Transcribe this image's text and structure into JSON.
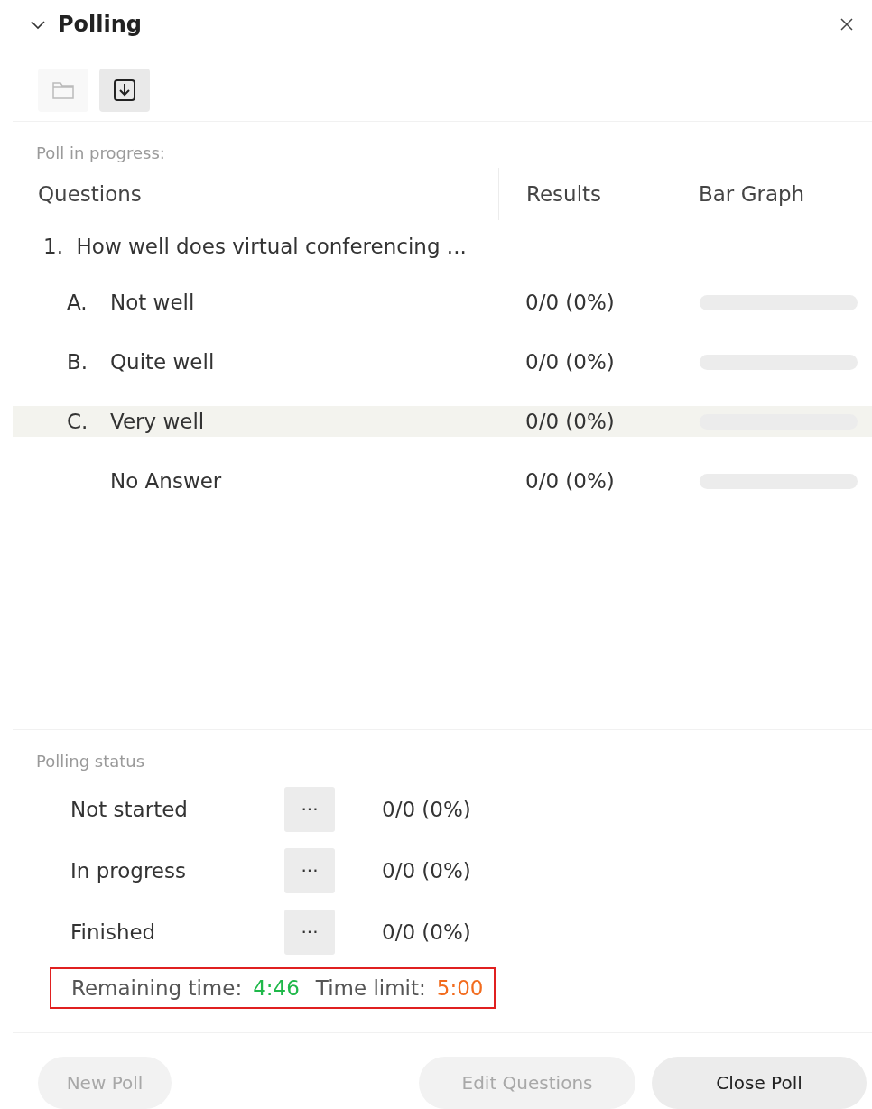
{
  "panel": {
    "title": "Polling",
    "expanded": true
  },
  "toolbar": [
    {
      "kind": "folder",
      "disabled": true
    },
    {
      "kind": "download",
      "disabled": false
    }
  ],
  "poll": {
    "caption": "Poll in progress:",
    "columns": [
      "Questions",
      "Results",
      "Bar Graph"
    ],
    "question": "1.  How well does virtual conferencing ...",
    "answers": [
      {
        "letter": "A.",
        "text": "Not well",
        "result": "0/0 (0%)",
        "level": 0,
        "selected": false
      },
      {
        "letter": "B.",
        "text": "Quite well",
        "result": "0/0 (0%)",
        "level": 0,
        "selected": false
      },
      {
        "letter": "C.",
        "text": "Very well",
        "result": "0/0 (0%)",
        "level": 0,
        "selected": true
      },
      {
        "text": "No Answer",
        "result": "0/0 (0%)",
        "level": 0,
        "selected": false
      }
    ]
  },
  "status": {
    "caption": "Polling status",
    "rows": [
      {
        "label": "Not started",
        "more": "···",
        "result": "0/0 (0%)"
      },
      {
        "label": "In progress",
        "more": "···",
        "result": "0/0 (0%)"
      },
      {
        "label": "Finished",
        "more": "···",
        "result": "0/0 (0%)"
      }
    ]
  },
  "timer": {
    "highlighted": true,
    "remaining_label": "Remaining time:",
    "remaining": "4:46",
    "limit_label": "Time limit:",
    "limit": "5:00"
  },
  "buttons": [
    {
      "label": "New Poll",
      "disabled": true
    },
    {
      "label": "Edit Questions",
      "disabled": true
    },
    {
      "label": "Close Poll",
      "disabled": false
    }
  ]
}
